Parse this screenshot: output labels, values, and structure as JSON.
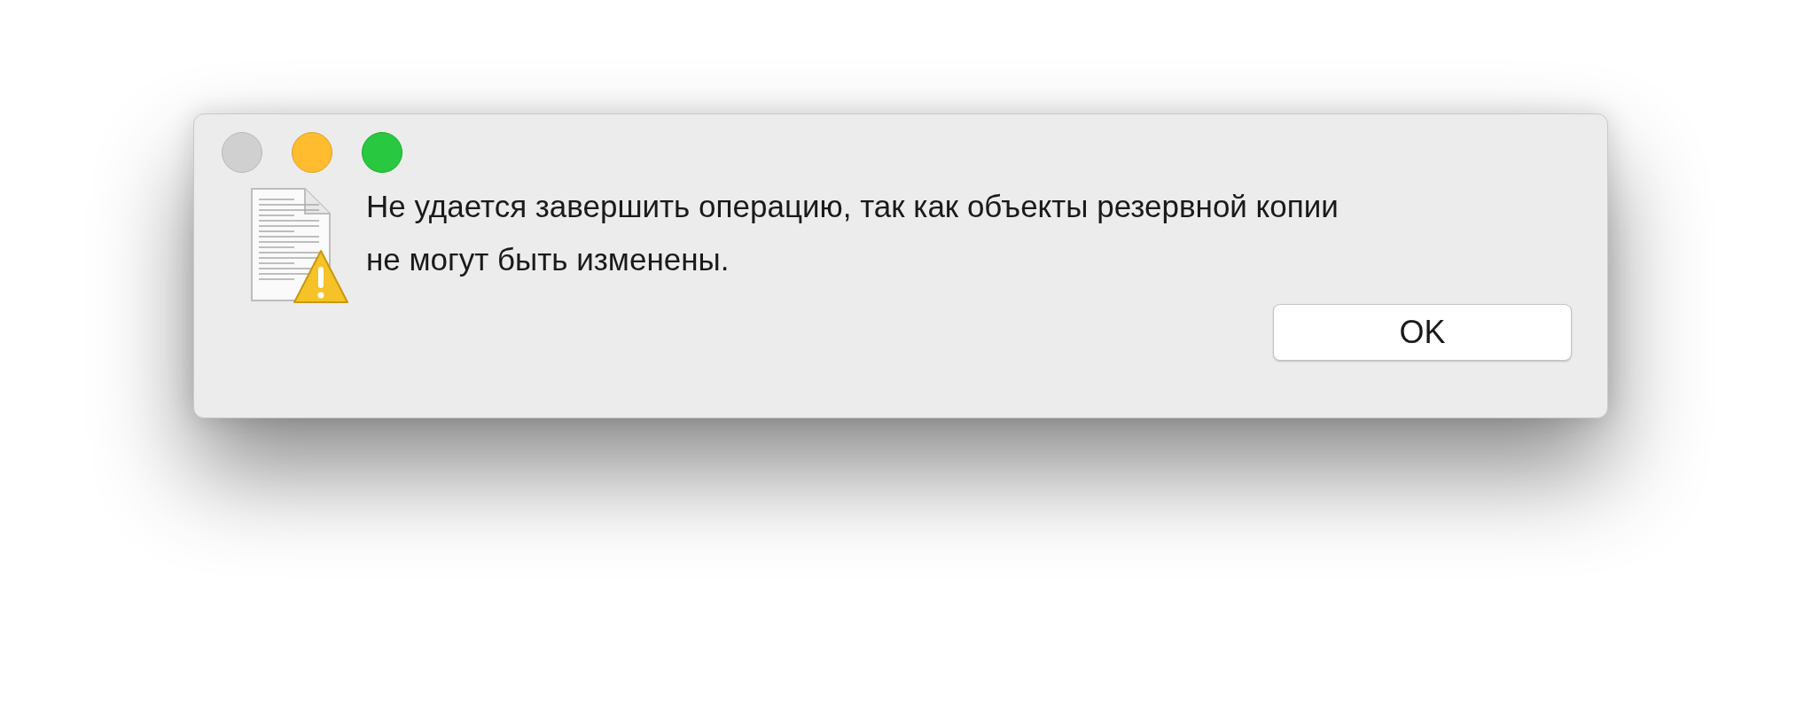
{
  "window_buttons": [
    {
      "kind": "close",
      "disabled": true
    },
    {
      "kind": "minimize",
      "disabled": false
    },
    {
      "kind": "zoom",
      "disabled": false
    }
  ],
  "alert": {
    "message": "Не удается завершить операцию, так как объекты резервной копии не могут быть изменены."
  },
  "buttons": [
    {
      "label": "OK"
    }
  ]
}
